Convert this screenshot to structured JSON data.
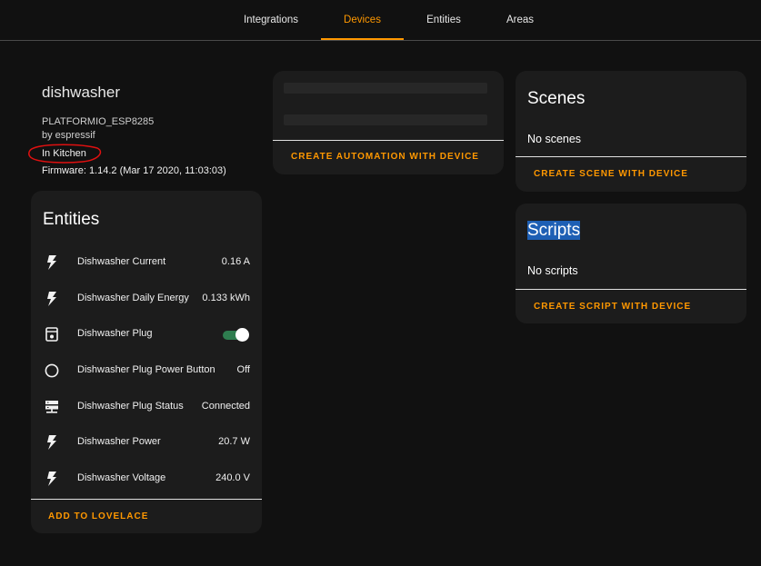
{
  "tabs": [
    {
      "label": "Integrations",
      "active": false
    },
    {
      "label": "Devices",
      "active": true
    },
    {
      "label": "Entities",
      "active": false
    },
    {
      "label": "Areas",
      "active": false
    }
  ],
  "device": {
    "name": "dishwasher",
    "model": "PLATFORMIO_ESP8285",
    "manufacturer": "by espressif",
    "area": "In Kitchen",
    "firmware": "Firmware: 1.14.2 (Mar 17 2020, 11:03:03)"
  },
  "entities_card": {
    "title": "Entities",
    "action": "ADD TO LOVELACE",
    "items": [
      {
        "icon": "flash-icon",
        "name": "Dishwasher Current",
        "value": "0.16 A"
      },
      {
        "icon": "flash-icon",
        "name": "Dishwasher Daily Energy",
        "value": "0.133 kWh"
      },
      {
        "icon": "dishwasher-icon",
        "name": "Dishwasher Plug",
        "value": "",
        "toggle_on": true
      },
      {
        "icon": "circle-outline-icon",
        "name": "Dishwasher Plug Power Button",
        "value": "Off"
      },
      {
        "icon": "server-network-icon",
        "name": "Dishwasher Plug Status",
        "value": "Connected"
      },
      {
        "icon": "flash-icon",
        "name": "Dishwasher Power",
        "value": "20.7 W"
      },
      {
        "icon": "flash-icon",
        "name": "Dishwasher Voltage",
        "value": "240.0 V"
      }
    ]
  },
  "automation_card": {
    "action": "CREATE AUTOMATION WITH DEVICE"
  },
  "scenes_card": {
    "title": "Scenes",
    "empty": "No scenes",
    "action": "CREATE SCENE WITH DEVICE"
  },
  "scripts_card": {
    "title": "Scripts",
    "empty": "No scripts",
    "action": "CREATE SCRIPT WITH DEVICE"
  },
  "colors": {
    "accent": "#ff9800",
    "background": "#111111",
    "card": "#1c1c1c",
    "toggle_on": "#2e7d4f",
    "selection": "#1e5fb4",
    "annotation": "#e01010"
  }
}
